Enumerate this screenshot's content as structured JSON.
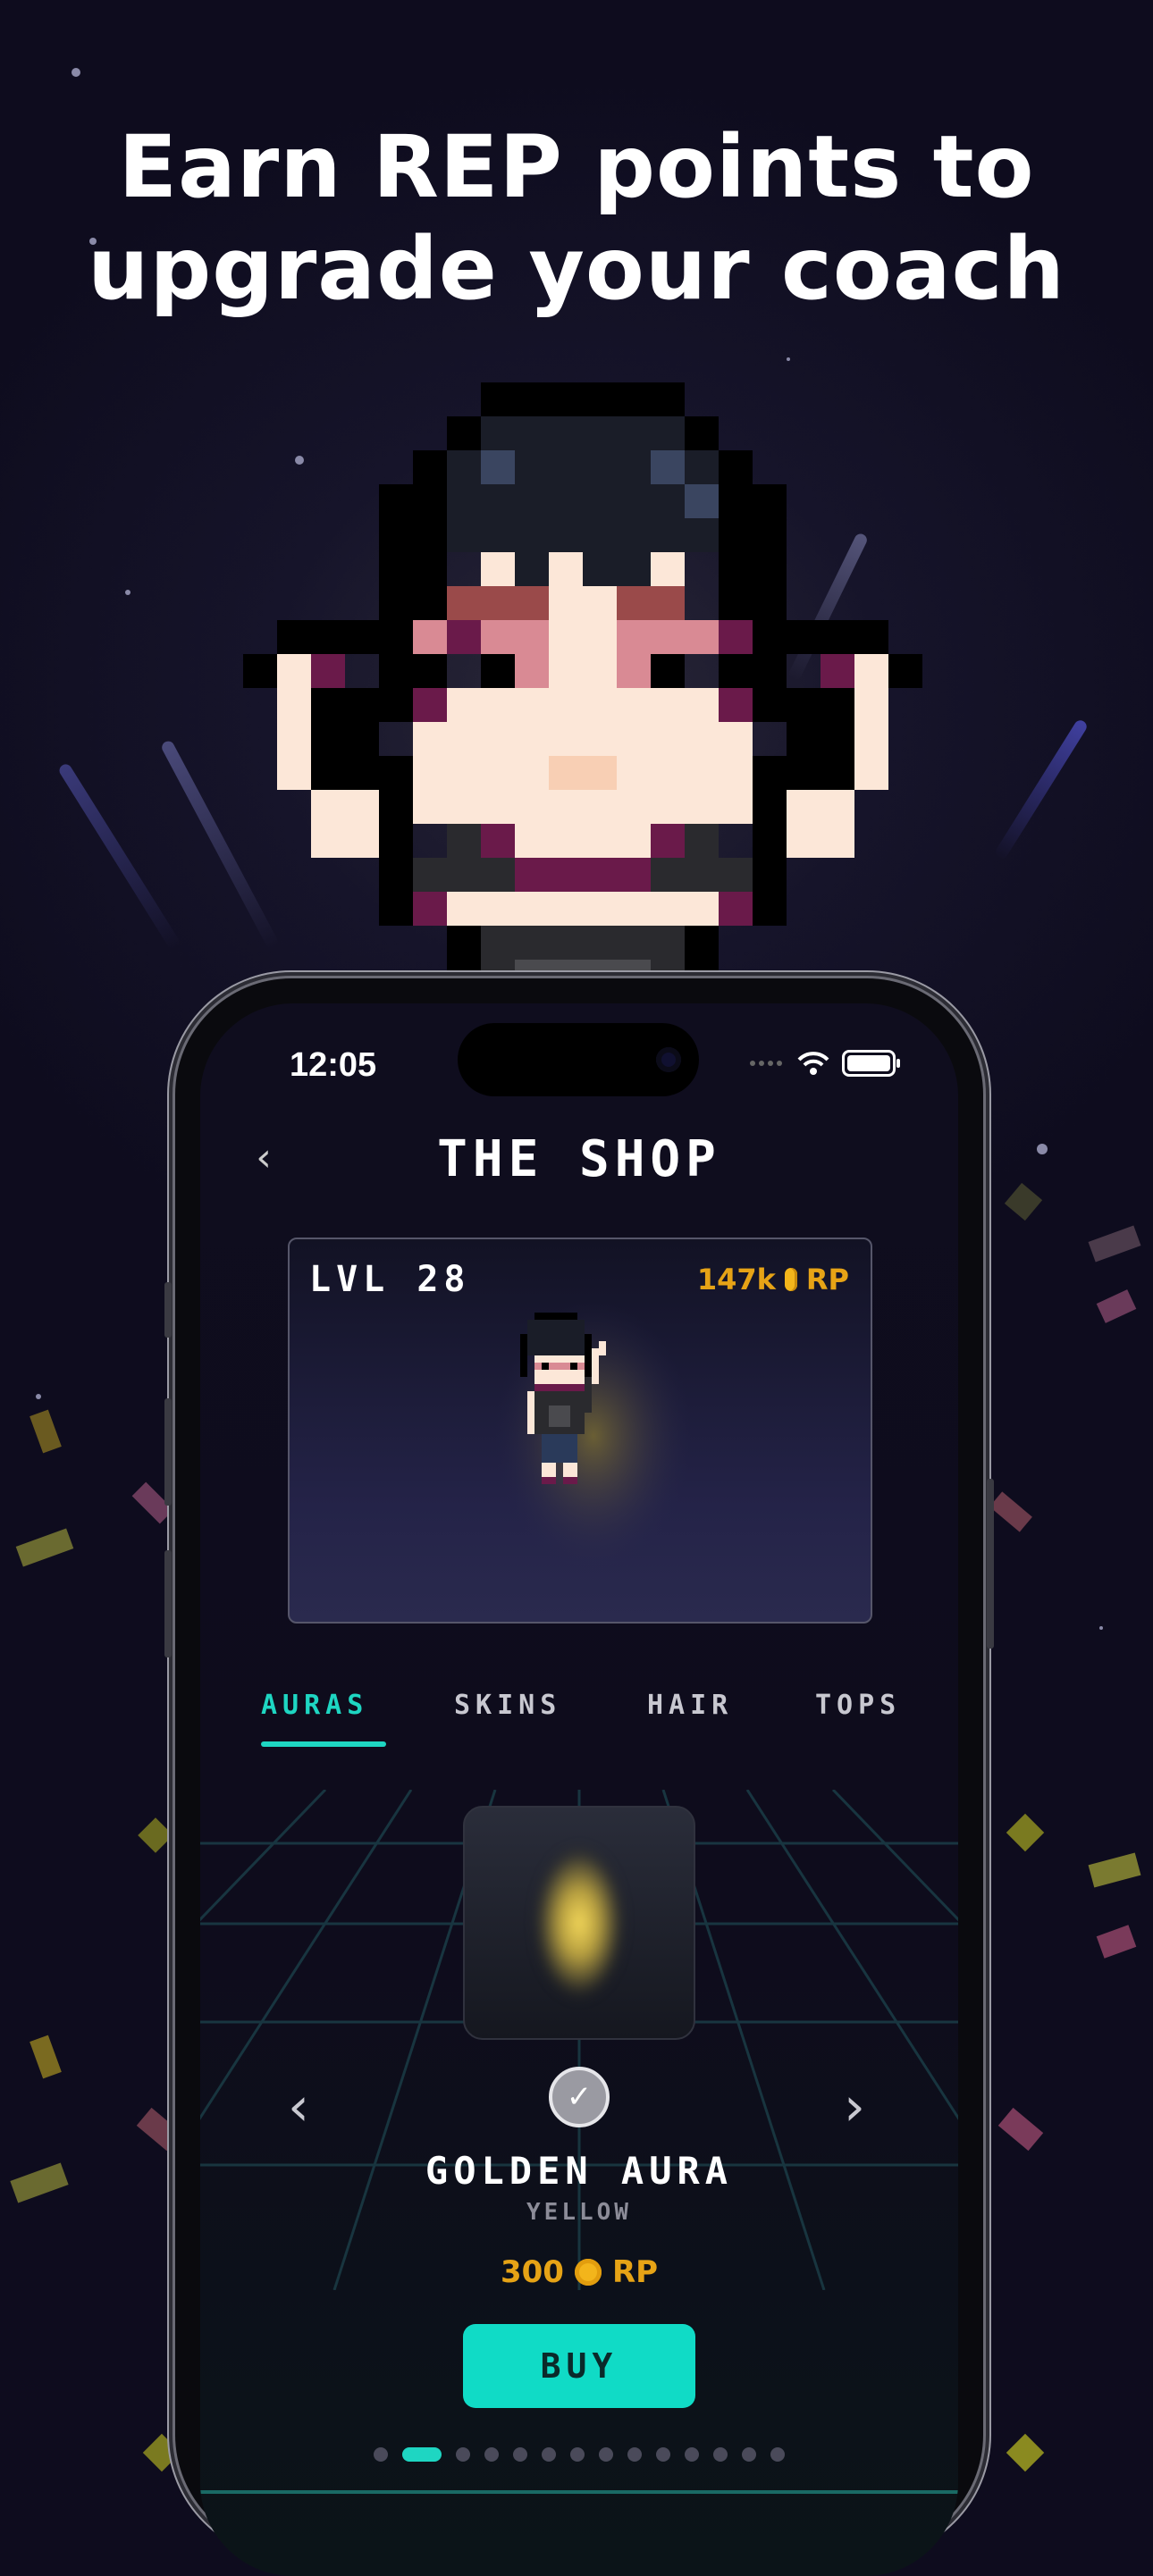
{
  "headline": {
    "line1": "Earn REP points to",
    "line2": "upgrade your coach"
  },
  "status_bar": {
    "time": "12:05"
  },
  "shop": {
    "title": "THE SHOP",
    "back_icon": "chevron-left-icon",
    "level": "LVL 28",
    "rp_balance": "147k",
    "rp_unit": "RP",
    "tabs": [
      {
        "label": "AURAS",
        "active": true
      },
      {
        "label": "SKINS",
        "active": false
      },
      {
        "label": "HAIR",
        "active": false
      },
      {
        "label": "TOPS",
        "active": false
      }
    ],
    "item": {
      "name": "GOLDEN AURA",
      "variant": "YELLOW",
      "price": "300",
      "price_unit": "RP",
      "owned_check": true
    },
    "buy_label": "BUY",
    "carousel": {
      "count": 14,
      "active_index": 1
    }
  },
  "colors": {
    "accent": "#1ed6c2",
    "gold": "#e6a316",
    "background": "#16142a"
  }
}
